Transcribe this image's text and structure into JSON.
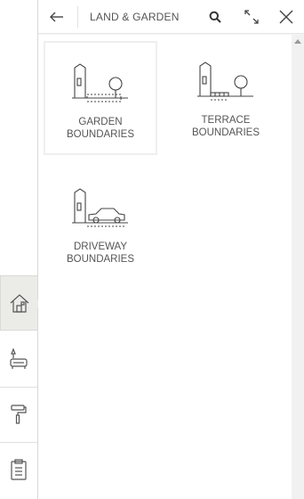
{
  "header": {
    "title": "LAND & GARDEN"
  },
  "tiles": [
    {
      "label_line1": "GARDEN",
      "label_line2": "BOUNDARIES"
    },
    {
      "label_line1": "TERRACE",
      "label_line2": "BOUNDARIES"
    },
    {
      "label_line1": "DRIVEWAY",
      "label_line2": "BOUNDARIES"
    }
  ],
  "rail": [
    {
      "icon": "house-icon",
      "active": true
    },
    {
      "icon": "sofa-lamp-icon",
      "active": false
    },
    {
      "icon": "paint-roller-icon",
      "active": false
    },
    {
      "icon": "clipboard-icon",
      "active": false
    }
  ],
  "colors": {
    "accent_bg": "#ebebe8",
    "panel_bg": "#f4f4f4",
    "text": "#555555"
  }
}
